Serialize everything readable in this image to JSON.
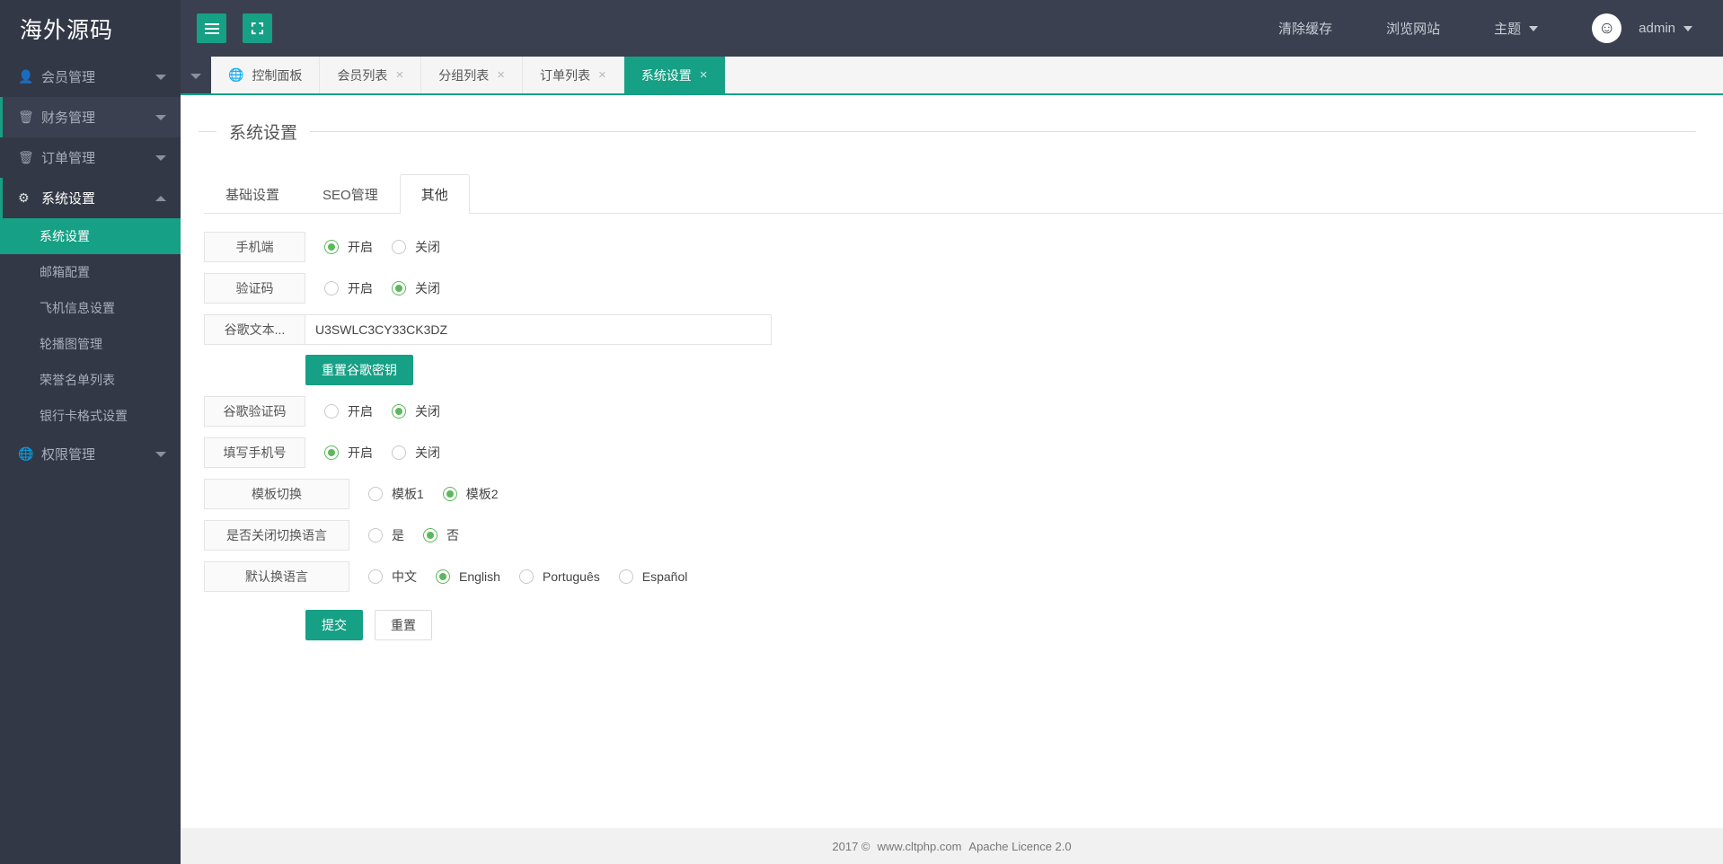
{
  "brand": {
    "title": "海外源码"
  },
  "topbar": {
    "menu_toggle_icon": "hamburger-icon",
    "fullscreen_icon": "expand-icon",
    "links": [
      {
        "label": "清除缓存",
        "caret": false
      },
      {
        "label": "浏览网站",
        "caret": false
      },
      {
        "label": "主题",
        "caret": true
      }
    ],
    "user": {
      "name": "admin",
      "avatar_icon": "smiley-avatar-icon",
      "caret": true
    }
  },
  "sidebar": {
    "items": [
      {
        "label": "会员管理",
        "icon": "user-icon",
        "state": "collapsed"
      },
      {
        "label": "财务管理",
        "icon": "database-icon",
        "state": "hover"
      },
      {
        "label": "订单管理",
        "icon": "database-icon",
        "state": "collapsed"
      },
      {
        "label": "系统设置",
        "icon": "wrench-icon",
        "state": "expanded"
      }
    ],
    "subitems": [
      {
        "label": "系统设置",
        "active": true
      },
      {
        "label": "邮箱配置",
        "active": false
      },
      {
        "label": "飞机信息设置",
        "active": false
      },
      {
        "label": "轮播图管理",
        "active": false
      },
      {
        "label": "荣誉名单列表",
        "active": false
      },
      {
        "label": "银行卡格式设置",
        "active": false
      }
    ],
    "last_item": {
      "label": "权限管理",
      "icon": "globe-icon",
      "state": "collapsed"
    }
  },
  "tabstrip": {
    "tabs": [
      {
        "label": "控制面板",
        "icon": "globe-icon",
        "closable": false,
        "active": false
      },
      {
        "label": "会员列表",
        "icon": "",
        "closable": true,
        "active": false
      },
      {
        "label": "分组列表",
        "icon": "",
        "closable": true,
        "active": false
      },
      {
        "label": "订单列表",
        "icon": "",
        "closable": true,
        "active": false
      },
      {
        "label": "系统设置",
        "icon": "",
        "closable": true,
        "active": true
      }
    ],
    "close_glyph": "×"
  },
  "page": {
    "title": "系统设置",
    "subtabs": [
      {
        "label": "基础设置",
        "active": false
      },
      {
        "label": "SEO管理",
        "active": false
      },
      {
        "label": "其他",
        "active": true
      }
    ]
  },
  "form": {
    "rows": [
      {
        "label": "手机端",
        "type": "radio",
        "options": [
          {
            "label": "开启",
            "selected": true
          },
          {
            "label": "关闭",
            "selected": false
          }
        ]
      },
      {
        "label": "验证码",
        "type": "radio",
        "options": [
          {
            "label": "开启",
            "selected": false
          },
          {
            "label": "关闭",
            "selected": true
          }
        ]
      },
      {
        "label": "谷歌文本...",
        "type": "text",
        "value": "U3SWLC3CY33CK3DZ",
        "placeholder": ""
      },
      {
        "label": "谷歌验证码",
        "type": "radio",
        "options": [
          {
            "label": "开启",
            "selected": false
          },
          {
            "label": "关闭",
            "selected": true
          }
        ]
      },
      {
        "label": "填写手机号",
        "type": "radio",
        "options": [
          {
            "label": "开启",
            "selected": true
          },
          {
            "label": "关闭",
            "selected": false
          }
        ]
      },
      {
        "label": "模板切换",
        "type": "radio",
        "wide": true,
        "options": [
          {
            "label": "模板1",
            "selected": false
          },
          {
            "label": "模板2",
            "selected": true
          }
        ]
      },
      {
        "label": "是否关闭切换语言",
        "type": "radio",
        "wide": true,
        "options": [
          {
            "label": "是",
            "selected": false
          },
          {
            "label": "否",
            "selected": true
          }
        ]
      },
      {
        "label": "默认换语言",
        "type": "radio",
        "wide": true,
        "options": [
          {
            "label": "中文",
            "selected": false
          },
          {
            "label": "English",
            "selected": true
          },
          {
            "label": "Português",
            "selected": false
          },
          {
            "label": "Español",
            "selected": false
          }
        ]
      }
    ],
    "reset_google_button": "重置谷歌密钥",
    "submit_button": "提交",
    "reset_button": "重置"
  },
  "footer": {
    "year": "2017 ©",
    "site": "www.cltphp.com",
    "licence": "Apache Licence 2.0"
  },
  "colors": {
    "accent": "#16a085",
    "sidebar_bg": "#323846",
    "topbar_bg": "#3a4050",
    "radio_on": "#5cb85c"
  }
}
